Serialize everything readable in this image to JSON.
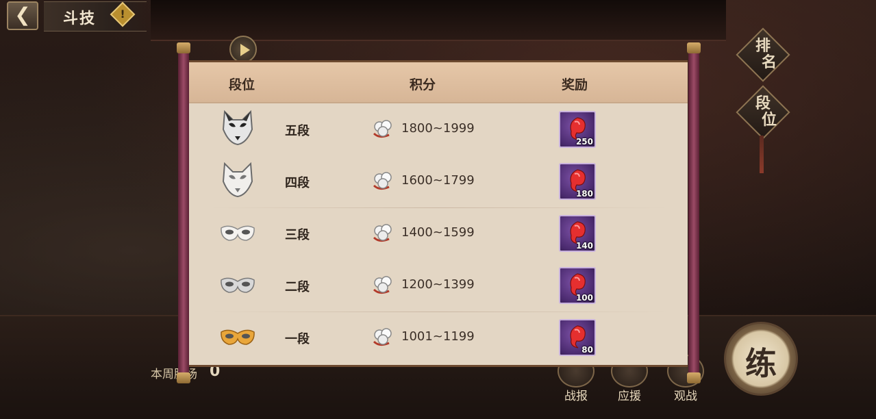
{
  "header": {
    "back_icon": "chevron-left-icon",
    "title": "斗技",
    "warn_glyph": "!"
  },
  "side_nav": {
    "ranking": "排名",
    "tier": "段位"
  },
  "bottom": {
    "weekly_label": "本周胜场",
    "weekly_value": "0",
    "battle_report": "战报",
    "support": "应援",
    "spectate": "观战",
    "practice": "练"
  },
  "table": {
    "headers": {
      "tier": "段位",
      "score": "积分",
      "reward": "奖励"
    },
    "rows": [
      {
        "tier": "五段",
        "range": "1800~1999",
        "reward": "250",
        "mask": "fox-mask-black-icon"
      },
      {
        "tier": "四段",
        "range": "1600~1799",
        "reward": "180",
        "mask": "fox-mask-white-icon"
      },
      {
        "tier": "三段",
        "range": "1400~1599",
        "reward": "140",
        "mask": "eye-mask-white-icon"
      },
      {
        "tier": "二段",
        "range": "1200~1399",
        "reward": "100",
        "mask": "eye-mask-silver-icon"
      },
      {
        "tier": "一段",
        "range": "1001~1199",
        "reward": "80",
        "mask": "eye-mask-gold-icon"
      }
    ]
  },
  "colors": {
    "panel": "#e3d6c4",
    "header": "#dcbd9e",
    "rod": "#8a3b56",
    "reward_bg": "#5a357f"
  }
}
